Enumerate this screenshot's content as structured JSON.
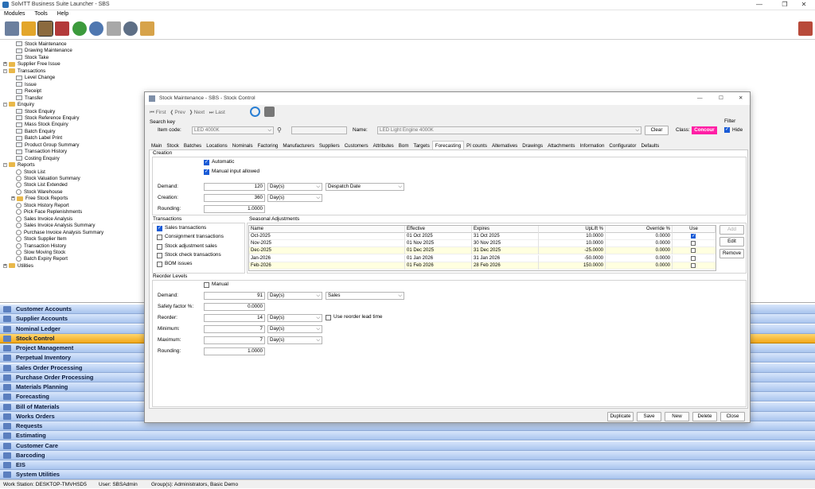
{
  "app": {
    "title": "SolvITT Business Suite Launcher - SBS"
  },
  "menu": [
    "Modules",
    "Tools",
    "Help"
  ],
  "tree": [
    {
      "label": "Stock Maintenance",
      "level": 2,
      "kind": "item"
    },
    {
      "label": "Drawing Maintenance",
      "level": 2,
      "kind": "item"
    },
    {
      "label": "Stock Take",
      "level": 2,
      "kind": "item"
    },
    {
      "label": "Supplier Free Issue",
      "level": 1,
      "kind": "folder",
      "pm": "+"
    },
    {
      "label": "Transactions",
      "level": 1,
      "kind": "folder",
      "pm": "-"
    },
    {
      "label": "Level Change",
      "level": 2,
      "kind": "item"
    },
    {
      "label": "Issue",
      "level": 2,
      "kind": "item"
    },
    {
      "label": "Receipt",
      "level": 2,
      "kind": "item"
    },
    {
      "label": "Transfer",
      "level": 2,
      "kind": "item"
    },
    {
      "label": "Enquiry",
      "level": 1,
      "kind": "folder",
      "pm": "-"
    },
    {
      "label": "Stock Enquiry",
      "level": 2,
      "kind": "item"
    },
    {
      "label": "Stock Reference Enquiry",
      "level": 2,
      "kind": "item"
    },
    {
      "label": "Mass Stock Enquiry",
      "level": 2,
      "kind": "item"
    },
    {
      "label": "Batch Enquiry",
      "level": 2,
      "kind": "item"
    },
    {
      "label": "Batch Label Print",
      "level": 2,
      "kind": "item"
    },
    {
      "label": "Product Group Summary",
      "level": 2,
      "kind": "item"
    },
    {
      "label": "Transaction History",
      "level": 2,
      "kind": "item"
    },
    {
      "label": "Costing Enquiry",
      "level": 2,
      "kind": "item"
    },
    {
      "label": "Reports",
      "level": 1,
      "kind": "folder",
      "pm": "-"
    },
    {
      "label": "Stock List",
      "level": 2,
      "kind": "report"
    },
    {
      "label": "Stock Valuation Summary",
      "level": 2,
      "kind": "report"
    },
    {
      "label": "Stock List Extended",
      "level": 2,
      "kind": "report"
    },
    {
      "label": "Stock Warehouse",
      "level": 2,
      "kind": "report"
    },
    {
      "label": "Free Stock Reports",
      "level": 2,
      "kind": "folder",
      "pm": "+"
    },
    {
      "label": "Stock History Report",
      "level": 2,
      "kind": "report"
    },
    {
      "label": "Pick Face Replenishments",
      "level": 2,
      "kind": "report"
    },
    {
      "label": "Sales Invoice Analysis",
      "level": 2,
      "kind": "report"
    },
    {
      "label": "Sales Invoice Analysis Summary",
      "level": 2,
      "kind": "report"
    },
    {
      "label": "Purchase Invoice Analysis Summary",
      "level": 2,
      "kind": "report"
    },
    {
      "label": "Stock Supplier Item",
      "level": 2,
      "kind": "report"
    },
    {
      "label": "Transaction History",
      "level": 2,
      "kind": "report"
    },
    {
      "label": "Slow Moving Stock",
      "level": 2,
      "kind": "report"
    },
    {
      "label": "Batch Expiry Report",
      "level": 2,
      "kind": "report"
    },
    {
      "label": "Utilities",
      "level": 1,
      "kind": "folder",
      "pm": "+"
    }
  ],
  "nav": [
    {
      "label": "Customer Accounts",
      "selected": false
    },
    {
      "label": "Supplier Accounts",
      "selected": false
    },
    {
      "label": "Nominal Ledger",
      "selected": false
    },
    {
      "label": "Stock Control",
      "selected": true
    },
    {
      "label": "Project Management",
      "selected": false
    },
    {
      "label": "Perpetual Inventory",
      "selected": false
    },
    {
      "label": "Sales Order Processing",
      "selected": false
    },
    {
      "label": "Purchase Order Processing",
      "selected": false
    },
    {
      "label": "Materials Planning",
      "selected": false
    },
    {
      "label": "Forecasting",
      "selected": false
    },
    {
      "label": "Bill of Materials",
      "selected": false
    },
    {
      "label": "Works Orders",
      "selected": false
    },
    {
      "label": "Requests",
      "selected": false
    },
    {
      "label": "Estimating",
      "selected": false
    },
    {
      "label": "Customer Care",
      "selected": false
    },
    {
      "label": "Barcoding",
      "selected": false
    },
    {
      "label": "EIS",
      "selected": false
    },
    {
      "label": "System Utilities",
      "selected": false
    }
  ],
  "status": {
    "workstation": "Work Station: DESKTOP-TMVHSD5",
    "user": "User: SBSAdmin",
    "groups": "Group(s): Administrators, Basic Demo"
  },
  "dialog": {
    "title": "Stock Maintenance - SBS - Stock Control",
    "nav": {
      "first": "First",
      "prev": "Prev",
      "next": "Next",
      "last": "Last"
    },
    "search_key": "Search key",
    "item_code_label": "Item code:",
    "item_code": "LED 4000K",
    "name_label": "Name:",
    "name": "LED Light Engine 4000K",
    "clear": "Clear",
    "class_label": "Class:",
    "class_value": "Concour",
    "filter_label": "Filter",
    "hide": "Hide",
    "tabs": [
      "Main",
      "Stock",
      "Batches",
      "Locations",
      "Nominals",
      "Factoring",
      "Manufacturers",
      "Suppliers",
      "Customers",
      "Attributes",
      "Bom",
      "Targets",
      "Forecasting",
      "PI counts",
      "Alternatives",
      "Drawings",
      "Attachments",
      "Information",
      "Configurator",
      "Defaults"
    ],
    "active_tab": "Forecasting",
    "creation": {
      "title": "Creation",
      "automatic": "Automatic",
      "manual_input": "Manual input allowed",
      "demand_label": "Demand:",
      "demand": "120",
      "demand_unit": "Day(s)",
      "demand_basis": "Despatch Date",
      "creation_label": "Creation:",
      "creation": "360",
      "creation_unit": "Day(s)",
      "rounding_label": "Rounding:",
      "rounding": "1.0000"
    },
    "transactions": {
      "title": "Transactions",
      "items": [
        {
          "label": "Sales transactions",
          "checked": true
        },
        {
          "label": "Consignment transactions",
          "checked": false
        },
        {
          "label": "Stock adjustment sales",
          "checked": false
        },
        {
          "label": "Stock check transactions",
          "checked": false
        },
        {
          "label": "BOM issues",
          "checked": false
        }
      ]
    },
    "seasonal": {
      "title": "Seasonal Adjustments",
      "columns": [
        "Name",
        "Effective",
        "Expires",
        "UpLift %",
        "Override %",
        "Use"
      ],
      "rows": [
        {
          "name": "Oct-2025",
          "effective": "01 Oct 2025",
          "expires": "31 Oct 2025",
          "uplift": "10.0000",
          "override": "0.0000",
          "use": true,
          "yellow": false
        },
        {
          "name": "Nov-2025",
          "effective": "01 Nov 2025",
          "expires": "30 Nov 2025",
          "uplift": "10.0000",
          "override": "0.0000",
          "use": false,
          "yellow": false
        },
        {
          "name": "Dec-2025",
          "effective": "01 Dec 2025",
          "expires": "31 Dec 2025",
          "uplift": "-25.0000",
          "override": "0.0000",
          "use": false,
          "yellow": true
        },
        {
          "name": "Jan-2026",
          "effective": "01 Jan 2026",
          "expires": "31 Jan 2026",
          "uplift": "-50.0000",
          "override": "0.0000",
          "use": false,
          "yellow": false
        },
        {
          "name": "Feb-2026",
          "effective": "01 Feb 2026",
          "expires": "28 Feb 2026",
          "uplift": "150.0000",
          "override": "0.0000",
          "use": false,
          "yellow": true
        }
      ],
      "add": "Add",
      "edit": "Edit",
      "remove": "Remove"
    },
    "reorder": {
      "title": "Reorder Levels",
      "manual": "Manual",
      "demand_label": "Demand:",
      "demand": "91",
      "demand_unit": "Day(s)",
      "demand_basis": "Sales",
      "safety_label": "Safety factor %:",
      "safety": "0.0000",
      "reorder_label": "Reorder:",
      "reorder": "14",
      "reorder_unit": "Day(s)",
      "lead_time": "Use reorder lead time",
      "minimum_label": "Minimum:",
      "minimum": "7",
      "minimum_unit": "Day(s)",
      "maximum_label": "Maximum:",
      "maximum": "7",
      "maximum_unit": "Day(s)",
      "rounding_label": "Rounding:",
      "rounding": "1.0000"
    },
    "buttons": {
      "duplicate": "Duplicate",
      "save": "Save",
      "new": "New",
      "delete": "Delete",
      "close": "Close"
    }
  }
}
